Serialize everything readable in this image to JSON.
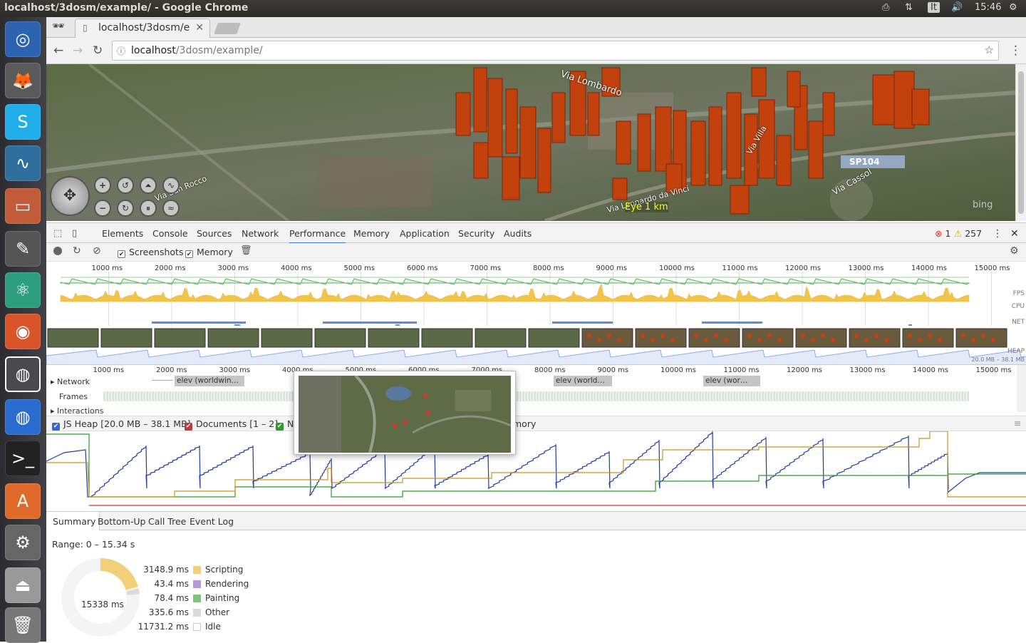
{
  "os": {
    "window_title": "localhost/3dosm/example/ - Google Chrome",
    "keyboard_layout": "It",
    "clock": "15:46"
  },
  "browser": {
    "tab_title": "localhost/3dosm/e",
    "url_host": "localhost",
    "url_path": "/3dosm/example/"
  },
  "map": {
    "road_labels": [
      "Via Lombardo",
      "Via San Rocco",
      "Via Leonardo da Vinci",
      "Via Cassol",
      "SP104",
      "Via Villa"
    ],
    "eye_label": "Eye  1 km",
    "attribution": "bing"
  },
  "devtools": {
    "tabs": [
      "Elements",
      "Console",
      "Sources",
      "Network",
      "Performance",
      "Memory",
      "Application",
      "Security",
      "Audits"
    ],
    "active_tab": "Performance",
    "errors": "1",
    "warnings": "257",
    "toolbar": {
      "screenshots": "Screenshots",
      "memory": "Memory"
    },
    "overview_ticks": [
      "1000 ms",
      "2000 ms",
      "3000 ms",
      "4000 ms",
      "5000 ms",
      "6000 ms",
      "7000 ms",
      "8000 ms",
      "9000 ms",
      "10000 ms",
      "11000 ms",
      "12000 ms",
      "13000 ms",
      "14000 ms",
      "15000 ms"
    ],
    "overview_labels": {
      "fps": "FPS",
      "cpu": "CPU",
      "net": "NET",
      "heap": "HEAP",
      "heap_range": "20.0 MB – 38.1 MB"
    },
    "tracks": {
      "network": "Network",
      "frames": "Frames",
      "interactions": "Interactions",
      "requests": [
        "elev (worldwin…",
        "elev (world…",
        "elev (wor…"
      ]
    },
    "memory_bar": {
      "js_heap": "JS Heap [20.0 MB – 38.1 MB]",
      "documents": "Documents [1 – 2]",
      "nodes_prefix": "N",
      "listeners_suffix": "mory"
    },
    "bottom_tabs": [
      "Summary",
      "Bottom-Up",
      "Call Tree",
      "Event Log"
    ],
    "range": "Range: 0 – 15.34 s",
    "total": "15338 ms",
    "summary": [
      {
        "value": "3148.9 ms",
        "label": "Scripting",
        "color": "#f2d07a"
      },
      {
        "value": "43.4 ms",
        "label": "Rendering",
        "color": "#b29ad8"
      },
      {
        "value": "78.4 ms",
        "label": "Painting",
        "color": "#7ec37d"
      },
      {
        "value": "335.6 ms",
        "label": "Other",
        "color": "#dadada"
      },
      {
        "value": "11731.2 ms",
        "label": "Idle",
        "color": "#ffffff"
      }
    ]
  }
}
